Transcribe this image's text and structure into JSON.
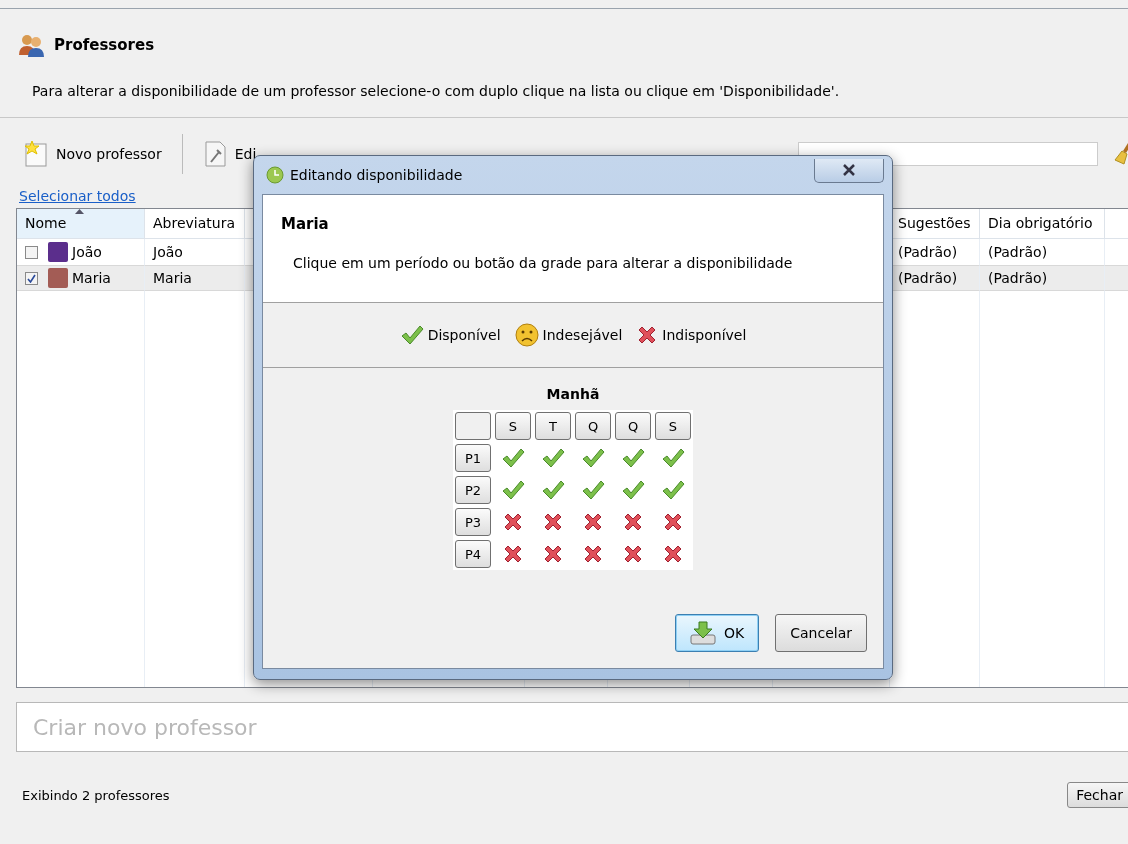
{
  "window": {
    "title": "Professores",
    "description": "Para alterar a disponibilidade de um professor selecione-o com duplo clique na lista ou clique em 'Disponibilidade'."
  },
  "toolbar": {
    "buttons": [
      {
        "label": "Novo professor",
        "kind": "new"
      },
      {
        "label": "Edi",
        "kind": "edit"
      }
    ]
  },
  "select_all_link": "Selecionar todos",
  "table": {
    "columns": [
      {
        "label": "Nome",
        "sorted": true
      },
      {
        "label": "Abreviatura",
        "sorted": false
      },
      {
        "label": "Sugestões",
        "sorted": false
      },
      {
        "label": "Dia obrigatório",
        "sorted": false
      }
    ],
    "rows": [
      {
        "checked": false,
        "selected": false,
        "color": "#5b2e8c",
        "name": "João",
        "abbreviation": "João",
        "suggestions": "(Padrão)",
        "required_day": "(Padrão)"
      },
      {
        "checked": true,
        "selected": true,
        "color": "#a35c55",
        "name": "Maria",
        "abbreviation": "Maria",
        "suggestions": "(Padrão)",
        "required_day": "(Padrão)"
      }
    ]
  },
  "new_field": {
    "placeholder": "Criar novo professor"
  },
  "status_bar": {
    "text": "Exibindo 2 professores",
    "close_button": "Fechar"
  },
  "dialog": {
    "title": "Editando disponibilidade",
    "teacher": "Maria",
    "instruction": "Clique em um período ou botão da grade para alterar a disponibilidade",
    "legend": [
      {
        "kind": "available",
        "label": "Disponível"
      },
      {
        "kind": "undesirable",
        "label": "Indesejável"
      },
      {
        "kind": "unavailable",
        "label": "Indisponível"
      }
    ],
    "section": "Manhã",
    "days": [
      "S",
      "T",
      "Q",
      "Q",
      "S"
    ],
    "periods": [
      {
        "label": "P1",
        "cells": [
          {
            "kind": "available"
          },
          {
            "kind": "available"
          },
          {
            "kind": "available"
          },
          {
            "kind": "available"
          },
          {
            "kind": "available"
          }
        ]
      },
      {
        "label": "P2",
        "cells": [
          {
            "kind": "available"
          },
          {
            "kind": "available"
          },
          {
            "kind": "available"
          },
          {
            "kind": "available"
          },
          {
            "kind": "available"
          }
        ]
      },
      {
        "label": "P3",
        "cells": [
          {
            "kind": "unavailable"
          },
          {
            "kind": "unavailable"
          },
          {
            "kind": "unavailable"
          },
          {
            "kind": "unavailable"
          },
          {
            "kind": "unavailable"
          }
        ]
      },
      {
        "label": "P4",
        "cells": [
          {
            "kind": "unavailable"
          },
          {
            "kind": "unavailable"
          },
          {
            "kind": "unavailable"
          },
          {
            "kind": "unavailable"
          },
          {
            "kind": "unavailable"
          }
        ]
      }
    ],
    "buttons": [
      {
        "label": "OK",
        "default": true
      },
      {
        "label": "Cancelar",
        "default": false
      }
    ]
  }
}
